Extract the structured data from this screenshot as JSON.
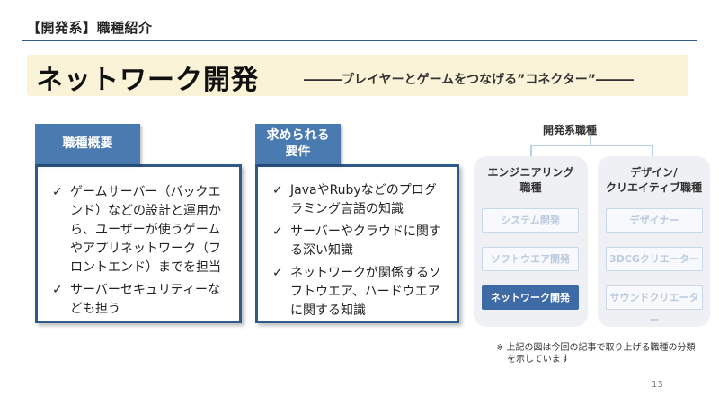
{
  "header": {
    "section_label": "【開発系】職種紹介"
  },
  "title": {
    "main": "ネットワーク開発",
    "subtitle": "―――プレイヤーとゲームをつなげる”コネクター”―――"
  },
  "overview_card": {
    "tab": "職種概要",
    "items": [
      "ゲームサーバー（バックエンド）などの設計と運用から、ユーザーが使うゲームやアプリネットワーク（フロントエンド）までを担当",
      "サーバーセキュリティーなども担う"
    ]
  },
  "requirements_card": {
    "tab_line1": "求められる",
    "tab_line2": "要件",
    "items": [
      "JavaやRubyなどのプログラミング言語の知識",
      "サーバーやクラウドに関する深い知識",
      "ネットワークが関係するソフトウエア、ハードウエアに関する知識"
    ]
  },
  "diagram": {
    "title": "開発系職種",
    "left_column": {
      "heading_line1": "エンジニアリング",
      "heading_line2": "職種",
      "roles": [
        "システム開発",
        "ソフトウエア開発",
        "ネットワーク開発"
      ],
      "active_index": 2
    },
    "right_column": {
      "heading_line1": "デザイン/",
      "heading_line2": "クリエイティブ職種",
      "roles": [
        "デザイナー",
        "3DCGクリエーター",
        "サウンドクリエーター"
      ]
    }
  },
  "footnote": {
    "line1": "※ 上記の図は今回の記事で取り上げる職種の分類",
    "line2": "を示しています"
  },
  "page_number": "13",
  "colors": {
    "accent": "#2f5a8c",
    "tab": "#4a7bb0",
    "title_band": "#fbf3d7",
    "active_role": "#3e6aa6"
  }
}
